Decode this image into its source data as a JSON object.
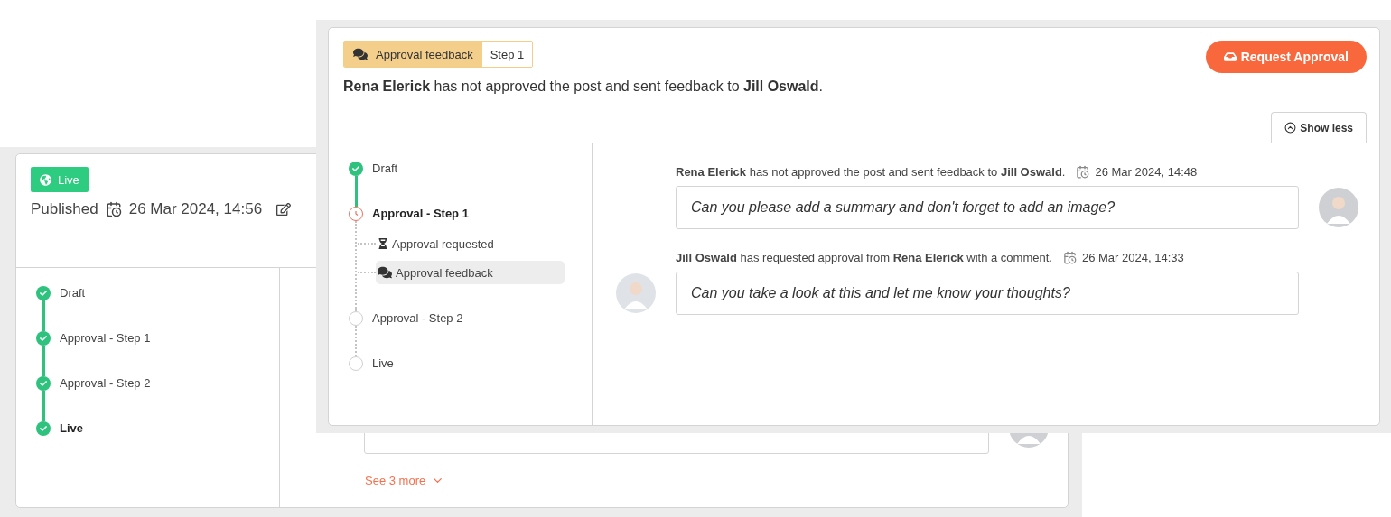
{
  "back_panel": {
    "status_badge": "Live",
    "published_label": "Published",
    "published_date": "26 Mar 2024, 14:56",
    "timeline": [
      {
        "label": "Draft",
        "kind": "done",
        "selected": false
      },
      {
        "label": "Approval - Step 1",
        "kind": "done",
        "selected": false
      },
      {
        "label": "Approval - Step 2",
        "kind": "done",
        "selected": false
      },
      {
        "label": "Live",
        "kind": "done",
        "selected": true
      }
    ],
    "see_more": "See 3 more"
  },
  "front_panel": {
    "badge": {
      "label": "Approval feedback",
      "step": "Step 1"
    },
    "button": "Request Approval",
    "summary": "**Rena Elerick** has not approved the post and sent feedback to **Jill Oswald**.",
    "toggle": "Show less",
    "timeline": [
      {
        "label": "Draft",
        "kind": "done",
        "selected": false
      },
      {
        "label": "Approval - Step 1",
        "kind": "current",
        "selected": true,
        "children": [
          {
            "label": "Approval requested",
            "kind": "requested",
            "selected": false
          },
          {
            "label": "Approval feedback",
            "kind": "feedback",
            "selected": true
          }
        ]
      },
      {
        "label": "Approval - Step 2",
        "kind": "pending",
        "selected": false
      },
      {
        "label": "Live",
        "kind": "pending",
        "selected": false
      }
    ],
    "messages": [
      {
        "header": "**Rena Elerick** has not approved the post and sent feedback to **Jill Oswald**.",
        "date": "26 Mar 2024, 14:48",
        "text": "Can you please add a summary and don't forget to add an image?",
        "kind": "incoming"
      },
      {
        "header": "**Jill Oswald** has requested approval from **Rena Elerick** with a comment.",
        "date": "26 Mar 2024, 14:33",
        "text": "Can you take a look at this and let me know your thoughts?",
        "kind": "outgoing"
      }
    ]
  }
}
